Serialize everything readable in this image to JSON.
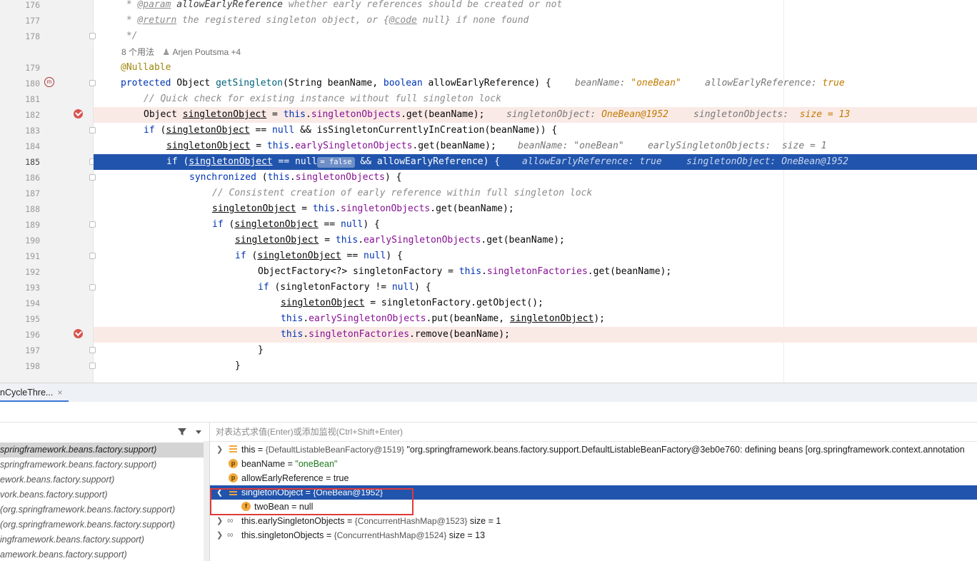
{
  "editor": {
    "lines": [
      {
        "n": "176"
      },
      {
        "n": "177"
      },
      {
        "n": "178"
      },
      {
        "n": "179"
      },
      {
        "n": "180"
      },
      {
        "n": "181"
      },
      {
        "n": "182"
      },
      {
        "n": "183"
      },
      {
        "n": "184"
      },
      {
        "n": "185"
      },
      {
        "n": "186"
      },
      {
        "n": "187"
      },
      {
        "n": "188"
      },
      {
        "n": "189"
      },
      {
        "n": "190"
      },
      {
        "n": "191"
      },
      {
        "n": "192"
      },
      {
        "n": "193"
      },
      {
        "n": "194"
      },
      {
        "n": "195"
      },
      {
        "n": "196"
      },
      {
        "n": "197"
      },
      {
        "n": "198"
      }
    ],
    "usages": "8 个用法",
    "author": "Arjen Poutsma +4",
    "code": {
      "l176a": " * ",
      "l176b": "@param",
      "l176c": " allowEarlyReference",
      "l176d": " whether early references should be created or not",
      "l177a": " * ",
      "l177b": "@return",
      "l177c": " the registered singleton object, or {",
      "l177d": "@code",
      "l177e": " null} if none found",
      "l178": " */",
      "l179": "@Nullable",
      "l180_kw": "protected",
      "l180_a": " Object ",
      "l180_fn": "getSingleton",
      "l180_b": "(String beanName, ",
      "l180_kw2": "boolean",
      "l180_c": " allowEarlyReference) {",
      "l180_h1": "beanName: ",
      "l180_h1v": "\"oneBean\"",
      "l180_h2": "allowEarlyReference: ",
      "l180_h2v": "true",
      "l181": "// Quick check for existing instance without full singleton lock",
      "l182_a": "Object ",
      "l182_v": "singletonObject",
      "l182_b": " = ",
      "l182_kw": "this",
      "l182_c": ".",
      "l182_f": "singletonObjects",
      "l182_d": ".get(beanName);",
      "l182_h1": "singletonObject: ",
      "l182_h1v": "OneBean@1952",
      "l182_h2": "singletonObjects: ",
      "l182_h2v": " size = 13",
      "l183_kw": "if",
      "l183_a": " (",
      "l183_v": "singletonObject",
      "l183_b": " == ",
      "l183_kw2": "null",
      "l183_c": " && isSingletonCurrentlyInCreation(beanName)) {",
      "l184_v": "singletonObject",
      "l184_a": " = ",
      "l184_kw": "this",
      "l184_b": ".",
      "l184_f": "earlySingletonObjects",
      "l184_c": ".get(beanName);",
      "l184_h1": "beanName: \"oneBean\"",
      "l184_h2": "earlySingletonObjects: ",
      "l184_h2v": " size = 1",
      "l185_a": "if (",
      "l185_v": "singletonObject",
      "l185_b": " == null",
      "l185_badge": "= false",
      "l185_c": " && allowEarlyReference) {",
      "l185_h1": "allowEarlyReference: true",
      "l185_h2": "singletonObject: ",
      "l185_h2v": "OneBean@1952",
      "l186_kw": "synchronized",
      "l186_a": " (",
      "l186_kw2": "this",
      "l186_b": ".",
      "l186_f": "singletonObjects",
      "l186_c": ") {",
      "l187": "// Consistent creation of early reference within full singleton lock",
      "l188_v": "singletonObject",
      "l188_a": " = ",
      "l188_kw": "this",
      "l188_b": ".",
      "l188_f": "singletonObjects",
      "l188_c": ".get(beanName);",
      "l189_kw": "if",
      "l189_a": " (",
      "l189_v": "singletonObject",
      "l189_b": " == ",
      "l189_kw2": "null",
      "l189_c": ") {",
      "l190_v": "singletonObject",
      "l190_a": " = ",
      "l190_kw": "this",
      "l190_b": ".",
      "l190_f": "earlySingletonObjects",
      "l190_c": ".get(beanName);",
      "l191_kw": "if",
      "l191_a": " (",
      "l191_v": "singletonObject",
      "l191_b": " == ",
      "l191_kw2": "null",
      "l191_c": ") {",
      "l192_a": "ObjectFactory<?> singletonFactory = ",
      "l192_kw": "this",
      "l192_b": ".",
      "l192_f": "singletonFactories",
      "l192_c": ".get(beanName);",
      "l193_kw": "if",
      "l193_a": " (singletonFactory != ",
      "l193_kw2": "null",
      "l193_b": ") {",
      "l194_v": "singletonObject",
      "l194_a": " = singletonFactory.getObject();",
      "l195_kw": "this",
      "l195_a": ".",
      "l195_f": "earlySingletonObjects",
      "l195_b": ".put(beanName, ",
      "l195_v": "singletonObject",
      "l195_c": ");",
      "l196_kw": "this",
      "l196_a": ".",
      "l196_f": "singletonFactories",
      "l196_b": ".remove(beanName);",
      "l197": "}",
      "l198": "}"
    }
  },
  "debug_tab": {
    "label": "nCycleThre...",
    "close": "×"
  },
  "frames": [
    {
      "label": "springframework.beans.factory.support)"
    },
    {
      "label": "springframework.beans.factory.support)"
    },
    {
      "label": "ework.beans.factory.support)"
    },
    {
      "label": "vork.beans.factory.support)"
    },
    {
      "label": " (org.springframework.beans.factory.support)"
    },
    {
      "label": " (org.springframework.beans.factory.support)"
    },
    {
      "label": "ingframework.beans.factory.support)"
    },
    {
      "label": "amework.beans.factory.support)"
    }
  ],
  "variables": {
    "eval_placeholder": "对表达式求值(Enter)或添加监视(Ctrl+Shift+Enter)",
    "rows": [
      {
        "name": "this",
        "eq": " = ",
        "type": "{DefaultListableBeanFactory@1519}",
        "value": " \"org.springframework.beans.factory.support.DefaultListableBeanFactory@3eb0e760: defining beans [org.springframework.context.annotation"
      },
      {
        "name": "beanName",
        "eq": " = ",
        "value": "\"oneBean\"",
        "icon": "p"
      },
      {
        "name": "allowEarlyReference",
        "eq": " = ",
        "value": "true",
        "icon": "p"
      },
      {
        "name": "singletonObject",
        "eq": " = ",
        "type": "{OneBean@1952}"
      },
      {
        "name": "twoBean",
        "eq": " = ",
        "value": "null",
        "icon": "f"
      },
      {
        "name": "this.earlySingletonObjects",
        "eq": " = ",
        "type": "{ConcurrentHashMap@1523}",
        "value": "  size = 1"
      },
      {
        "name": "this.singletonObjects",
        "eq": " = ",
        "type": "{ConcurrentHashMap@1524}",
        "value": "  size = 13"
      }
    ]
  },
  "colors": {
    "exec_line": "#2154ac",
    "breakpoint": "#d9534f",
    "highlight_box": "#e03a3a"
  }
}
